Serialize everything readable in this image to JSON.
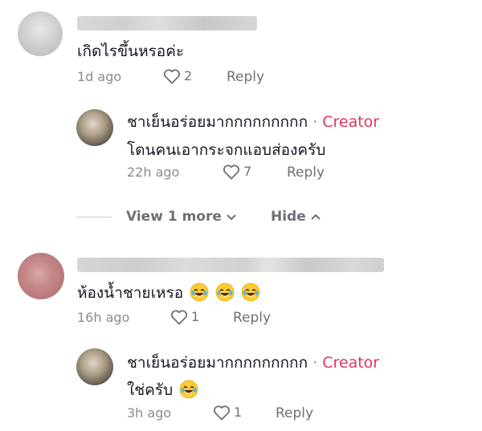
{
  "comments": [
    {
      "text": "เกิดไรขึ้นหรอค่ะ",
      "time": "1d ago",
      "likes": "2",
      "reply_label": "Reply",
      "reply": {
        "username": "ชาเย็นอร่อยมากกกกกกกกก",
        "separator": "·",
        "badge": "Creator",
        "text": "โดนคนเอากระจกแอบส่องครับ",
        "time": "22h ago",
        "likes": "7",
        "reply_label": "Reply"
      },
      "thread_controls": {
        "view_more": "View 1 more",
        "hide": "Hide"
      }
    },
    {
      "text": "ห้องน้ำชายเหรอ",
      "emoji_count_after_text": 3,
      "time": "16h ago",
      "likes": "1",
      "reply_label": "Reply",
      "reply": {
        "username": "ชาเย็นอร่อยมากกกกกกกกก",
        "separator": "·",
        "badge": "Creator",
        "text": "ใช่ครับ",
        "emoji_count_after_text": 1,
        "time": "3h ago",
        "likes": "1",
        "reply_label": "Reply"
      }
    }
  ],
  "colors": {
    "creator": "#e0365e",
    "meta": "#8a8b91"
  },
  "icons": [
    "heart-outline-icon",
    "chevron-down-icon",
    "chevron-up-icon",
    "laughing-tears-emoji"
  ]
}
